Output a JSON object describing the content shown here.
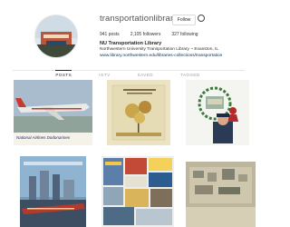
{
  "profile": {
    "username": "transportationlibrary",
    "follow_label": "Follow",
    "stats": {
      "posts": "941 posts",
      "followers": "2,105 followers",
      "following": "327 following"
    },
    "bio_name": "NU Transportation Library",
    "bio_desc": "Northwestern University Transportation Library ~ Evanston, IL",
    "bio_link": "www.library.northwestern.edu/libraries-collections/transportation"
  },
  "tabs": [
    "POSTS",
    "IGTV",
    "SAVED",
    "TAGGED"
  ],
  "grid": {
    "tile1_caption": "National Airlines Dodonarines"
  },
  "colors": {
    "link": "#003569",
    "accent": "#b22b2b"
  }
}
